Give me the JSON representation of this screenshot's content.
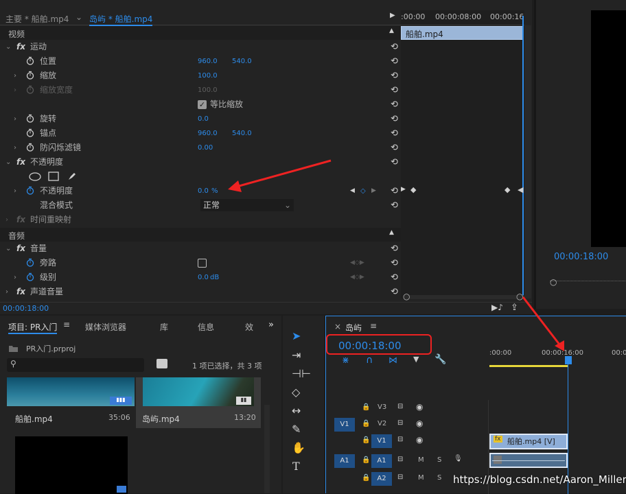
{
  "effects_panel": {
    "tab_main": "主要 * 船舶.mp4",
    "tab_clip": "岛屿 * 船舶.mp4",
    "section_video": "视频",
    "section_audio": "音频",
    "timeline": {
      "ruler": [
        ":00:00",
        "00:00:08:00",
        "00:00:16"
      ],
      "clip": "船舶.mp4"
    },
    "rows": {
      "motion": "运动",
      "position": {
        "label": "位置",
        "x": "960.0",
        "y": "540.0"
      },
      "scale": {
        "label": "缩放",
        "value": "100.0"
      },
      "scale_width": {
        "label": "缩放宽度",
        "value": "100.0"
      },
      "uniform_scale": "等比缩放",
      "rotation": {
        "label": "旋转",
        "value": "0.0"
      },
      "anchor": {
        "label": "锚点",
        "x": "960.0",
        "y": "540.0"
      },
      "antiflicker": {
        "label": "防闪烁滤镜",
        "value": "0.00"
      },
      "opacity_group": "不透明度",
      "opacity": {
        "label": "不透明度",
        "value": "0.0",
        "unit": "%"
      },
      "blend_mode": {
        "label": "混合模式",
        "value": "正常"
      },
      "time_remap": "时间重映射",
      "volume_group": "音量",
      "bypass": "旁路",
      "level": {
        "label": "级别",
        "value": "0.0",
        "unit": "dB"
      },
      "channel_volume": "声道音量"
    },
    "current_time": "00:00:18:00"
  },
  "program_monitor": {
    "timecode": "00:00:18:00"
  },
  "project_panel": {
    "tabs": [
      "项目: PR入门",
      "媒体浏览器",
      "库",
      "信息",
      "效"
    ],
    "project_file": "PR入门.prproj",
    "search_placeholder": "",
    "selection_status": "1 项已选择，共 3 项",
    "items": [
      {
        "name": "船舶.mp4",
        "duration": "35:06"
      },
      {
        "name": "岛屿.mp4",
        "duration": "13:20"
      }
    ]
  },
  "timeline_panel": {
    "tab": "岛屿",
    "timecode": "00:00:18:00",
    "ruler": [
      ":00:00",
      "00:00:16:00",
      "00:0"
    ],
    "tracks": [
      {
        "src": "",
        "name": "V3"
      },
      {
        "src": "V1",
        "name": "V2"
      },
      {
        "src": "",
        "name": "V1"
      },
      {
        "src": "A1",
        "name": "A1",
        "m": "M",
        "s": "S"
      },
      {
        "src": "",
        "name": "A2",
        "m": "M",
        "s": "S"
      }
    ],
    "video_clip": "船舶.mp4 [V]"
  },
  "watermark": "https://blog.csdn.net/Aaron_Miller"
}
